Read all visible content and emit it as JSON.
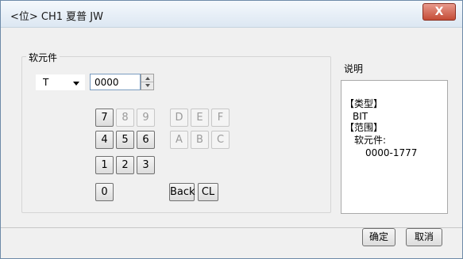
{
  "window": {
    "title": "<位> CH1 夏普 JW",
    "close_label": "X"
  },
  "device_group": {
    "label": "软元件",
    "type_select": {
      "value": "T"
    },
    "address_input": {
      "value": "0000"
    },
    "keypad": {
      "digits": [
        "7",
        "8",
        "9",
        "4",
        "5",
        "6",
        "1",
        "2",
        "3",
        "0"
      ],
      "hex": [
        "D",
        "E",
        "F",
        "A",
        "B",
        "C"
      ],
      "back_label": "Back",
      "clear_label": "CL"
    }
  },
  "description": {
    "label": "说明",
    "lines": [
      "【类型】",
      "BIT",
      "【范围】",
      "软元件:",
      "0000-1777"
    ]
  },
  "footer": {
    "ok_label": "确定",
    "cancel_label": "取消"
  }
}
